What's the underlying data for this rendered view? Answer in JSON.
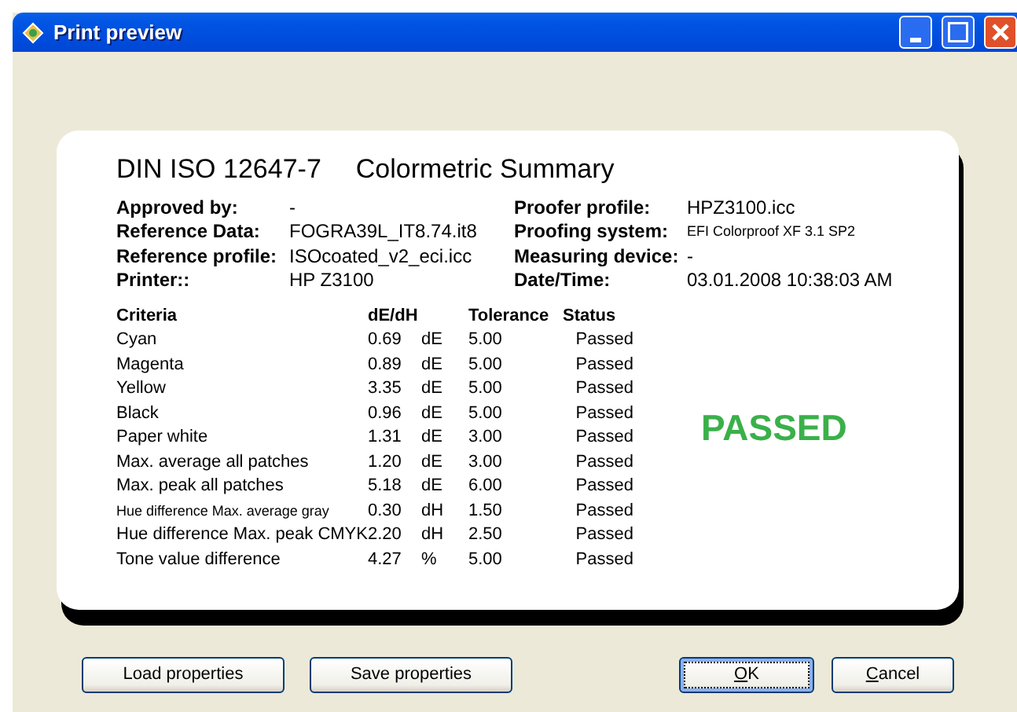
{
  "window": {
    "title": "Print preview"
  },
  "report": {
    "title": "DIN ISO 12647-7",
    "subtitle": "Colormetric Summary",
    "info_left": [
      {
        "label": "Approved by:",
        "value": "-"
      },
      {
        "label": "Reference Data:",
        "value": "FOGRA39L_IT8.74.it8"
      },
      {
        "label": "Reference profile:",
        "value": "ISOcoated_v2_eci.icc"
      },
      {
        "label": "Printer::",
        "value": "HP Z3100"
      }
    ],
    "info_right": [
      {
        "label": "Proofer profile:",
        "value": "HPZ3100.icc",
        "compact": false
      },
      {
        "label": "Proofing system:",
        "value": "EFI Colorproof XF 3.1 SP2",
        "compact": true
      },
      {
        "label": "Measuring device:",
        "value": "-",
        "compact": false
      },
      {
        "label": "Date/Time:",
        "value": "03.01.2008 10:38:03 AM",
        "compact": false
      }
    ],
    "table": {
      "columns": [
        "Criteria",
        "dE/dH",
        "Tolerance",
        "Status"
      ],
      "rows": [
        {
          "criteria": "Cyan",
          "value": "0.69",
          "unit": "dE",
          "tolerance": "5.00",
          "status": "Passed",
          "compact": false
        },
        {
          "criteria": "Magenta",
          "value": "0.89",
          "unit": "dE",
          "tolerance": "5.00",
          "status": "Passed",
          "compact": false
        },
        {
          "criteria": "Yellow",
          "value": "3.35",
          "unit": "dE",
          "tolerance": "5.00",
          "status": "Passed",
          "compact": false
        },
        {
          "criteria": "Black",
          "value": "0.96",
          "unit": "dE",
          "tolerance": "5.00",
          "status": "Passed",
          "compact": false
        },
        {
          "criteria": "Paper white",
          "value": "1.31",
          "unit": "dE",
          "tolerance": "3.00",
          "status": "Passed",
          "compact": false
        },
        {
          "criteria": "Max. average all patches",
          "value": "1.20",
          "unit": "dE",
          "tolerance": "3.00",
          "status": "Passed",
          "compact": false
        },
        {
          "criteria": "Max. peak all patches",
          "value": "5.18",
          "unit": "dE",
          "tolerance": "6.00",
          "status": "Passed",
          "compact": false
        },
        {
          "criteria": "Hue difference Max. average gray",
          "value": "0.30",
          "unit": "dH",
          "tolerance": "1.50",
          "status": "Passed",
          "compact": true
        },
        {
          "criteria": "Hue difference Max. peak CMYK",
          "value": "2.20",
          "unit": "dH",
          "tolerance": "2.50",
          "status": "Passed",
          "compact": false
        },
        {
          "criteria": "Tone value difference",
          "value": "4.27",
          "unit": "%",
          "tolerance": "5.00",
          "status": "Passed",
          "compact": false
        }
      ]
    },
    "result": "PASSED"
  },
  "buttons_left": [
    {
      "label": "Load properties",
      "focused": false,
      "underline_first": false
    },
    {
      "label": "Save properties",
      "focused": false,
      "underline_first": false
    }
  ],
  "buttons_right": [
    {
      "label": "OK",
      "focused": true,
      "underline_first": true
    },
    {
      "label": "Cancel",
      "focused": false,
      "underline_first": true
    }
  ]
}
